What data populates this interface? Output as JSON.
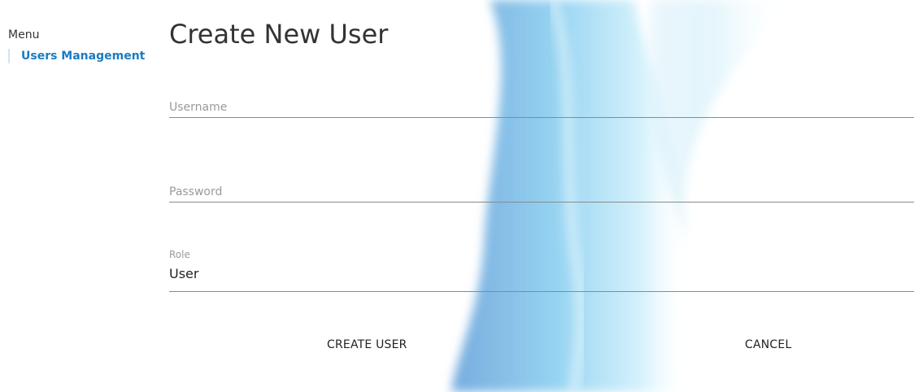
{
  "sidebar": {
    "title": "Menu",
    "items": [
      {
        "label": "Users Management"
      }
    ]
  },
  "form": {
    "title": "Create New User",
    "username": {
      "placeholder": "Username",
      "value": ""
    },
    "password": {
      "placeholder": "Password",
      "value": ""
    },
    "role": {
      "label": "Role",
      "value": "User"
    }
  },
  "actions": {
    "create_label": "CREATE USER",
    "cancel_label": "CANCEL"
  },
  "colors": {
    "accent": "#1a7bc2",
    "swirl_light": "#b9e6f7",
    "swirl_dark": "#6aa9dd"
  }
}
